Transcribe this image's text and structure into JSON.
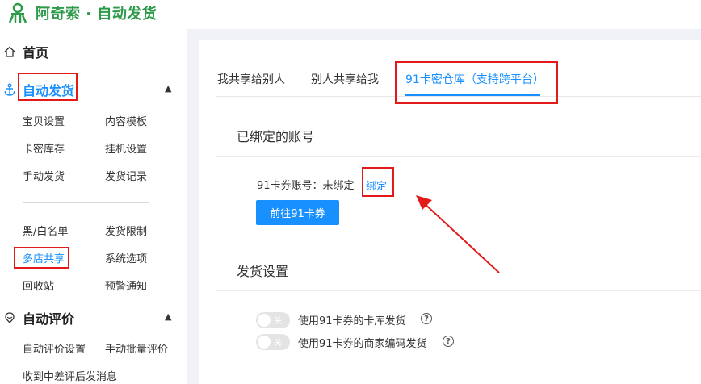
{
  "app": {
    "title": "阿奇索 · 自动发货"
  },
  "sidebar": {
    "home": {
      "label": "首页",
      "icon": "home-icon"
    },
    "auto_ship": {
      "label": "自动发货",
      "icon": "anchor-icon",
      "items": [
        "宝贝设置",
        "内容模板",
        "卡密库存",
        "挂机设置",
        "手动发货",
        "发货记录",
        "黑/白名单",
        "发货限制",
        "多店共享",
        "系统选项",
        "回收站",
        "预警通知"
      ]
    },
    "auto_review": {
      "label": "自动评价",
      "icon": "review-icon",
      "items": [
        "自动评价设置",
        "手动批量评价",
        "收到中差评后发消息"
      ]
    }
  },
  "tabs": [
    "我共享给别人",
    "别人共享给我",
    "91卡密仓库（支持跨平台）"
  ],
  "bound_account": {
    "title": "已绑定的账号",
    "account_label": "91卡券账号：未绑定",
    "bind_link": "绑定",
    "goto_button": "前往91卡券"
  },
  "ship_settings": {
    "title": "发货设置",
    "options": [
      {
        "toggle": "关",
        "label": "使用91卡券的卡库发货"
      },
      {
        "toggle": "关",
        "label": "使用91卡券的商家编码发货"
      }
    ]
  },
  "colors": {
    "accent": "#1890ff",
    "brand": "#2d9a4a",
    "annotation": "#e21a1a"
  }
}
